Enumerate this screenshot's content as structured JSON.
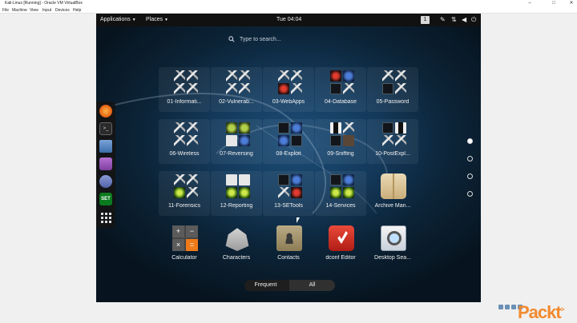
{
  "host": {
    "window_title": "Kali-Linux [Running] - Oracle VM VirtualBox",
    "menu": [
      "File",
      "Machine",
      "View",
      "Input",
      "Devices",
      "Help"
    ],
    "controls": [
      "–",
      "□",
      "✕"
    ],
    "watermark": "Packt",
    "watermark_mark": ">"
  },
  "topbar": {
    "applications": "Applications",
    "places": "Places",
    "clock": "Tue 04:04",
    "workspace": "1",
    "tray_icons": [
      "pen-icon",
      "network-icon",
      "volume-icon",
      "power-icon"
    ]
  },
  "search": {
    "placeholder": "Type to search..."
  },
  "dash": [
    "firefox-icon",
    "terminal-icon",
    "files-icon",
    "tweak-icon",
    "stack-icon",
    "set-icon",
    "show-apps-icon"
  ],
  "dash_set_label": "SET",
  "apps": [
    {
      "label": "01-Informati..."
    },
    {
      "label": "02-Vulnerab..."
    },
    {
      "label": "03-WebApps"
    },
    {
      "label": "04-Database"
    },
    {
      "label": "05-Password"
    },
    {
      "label": "06-Wireless"
    },
    {
      "label": "07-Reversing"
    },
    {
      "label": "08-Exploit"
    },
    {
      "label": "09-Sniffing"
    },
    {
      "label": "10-PostExpl..."
    },
    {
      "label": "11-Forensics"
    },
    {
      "label": "12-Reporting"
    },
    {
      "label": "13-SETools"
    },
    {
      "label": "14-Services"
    },
    {
      "label": "Archive Man..."
    },
    {
      "label": "Calculator"
    },
    {
      "label": "Characters"
    },
    {
      "label": "Contacts"
    },
    {
      "label": "dconf Editor"
    },
    {
      "label": "Desktop Sea..."
    }
  ],
  "calculator_keys": [
    "+",
    "−",
    "×",
    "="
  ],
  "pager": {
    "pages": 4,
    "current": 1
  },
  "view_switch": {
    "frequent": "Frequent",
    "all": "All",
    "selected": "All"
  }
}
